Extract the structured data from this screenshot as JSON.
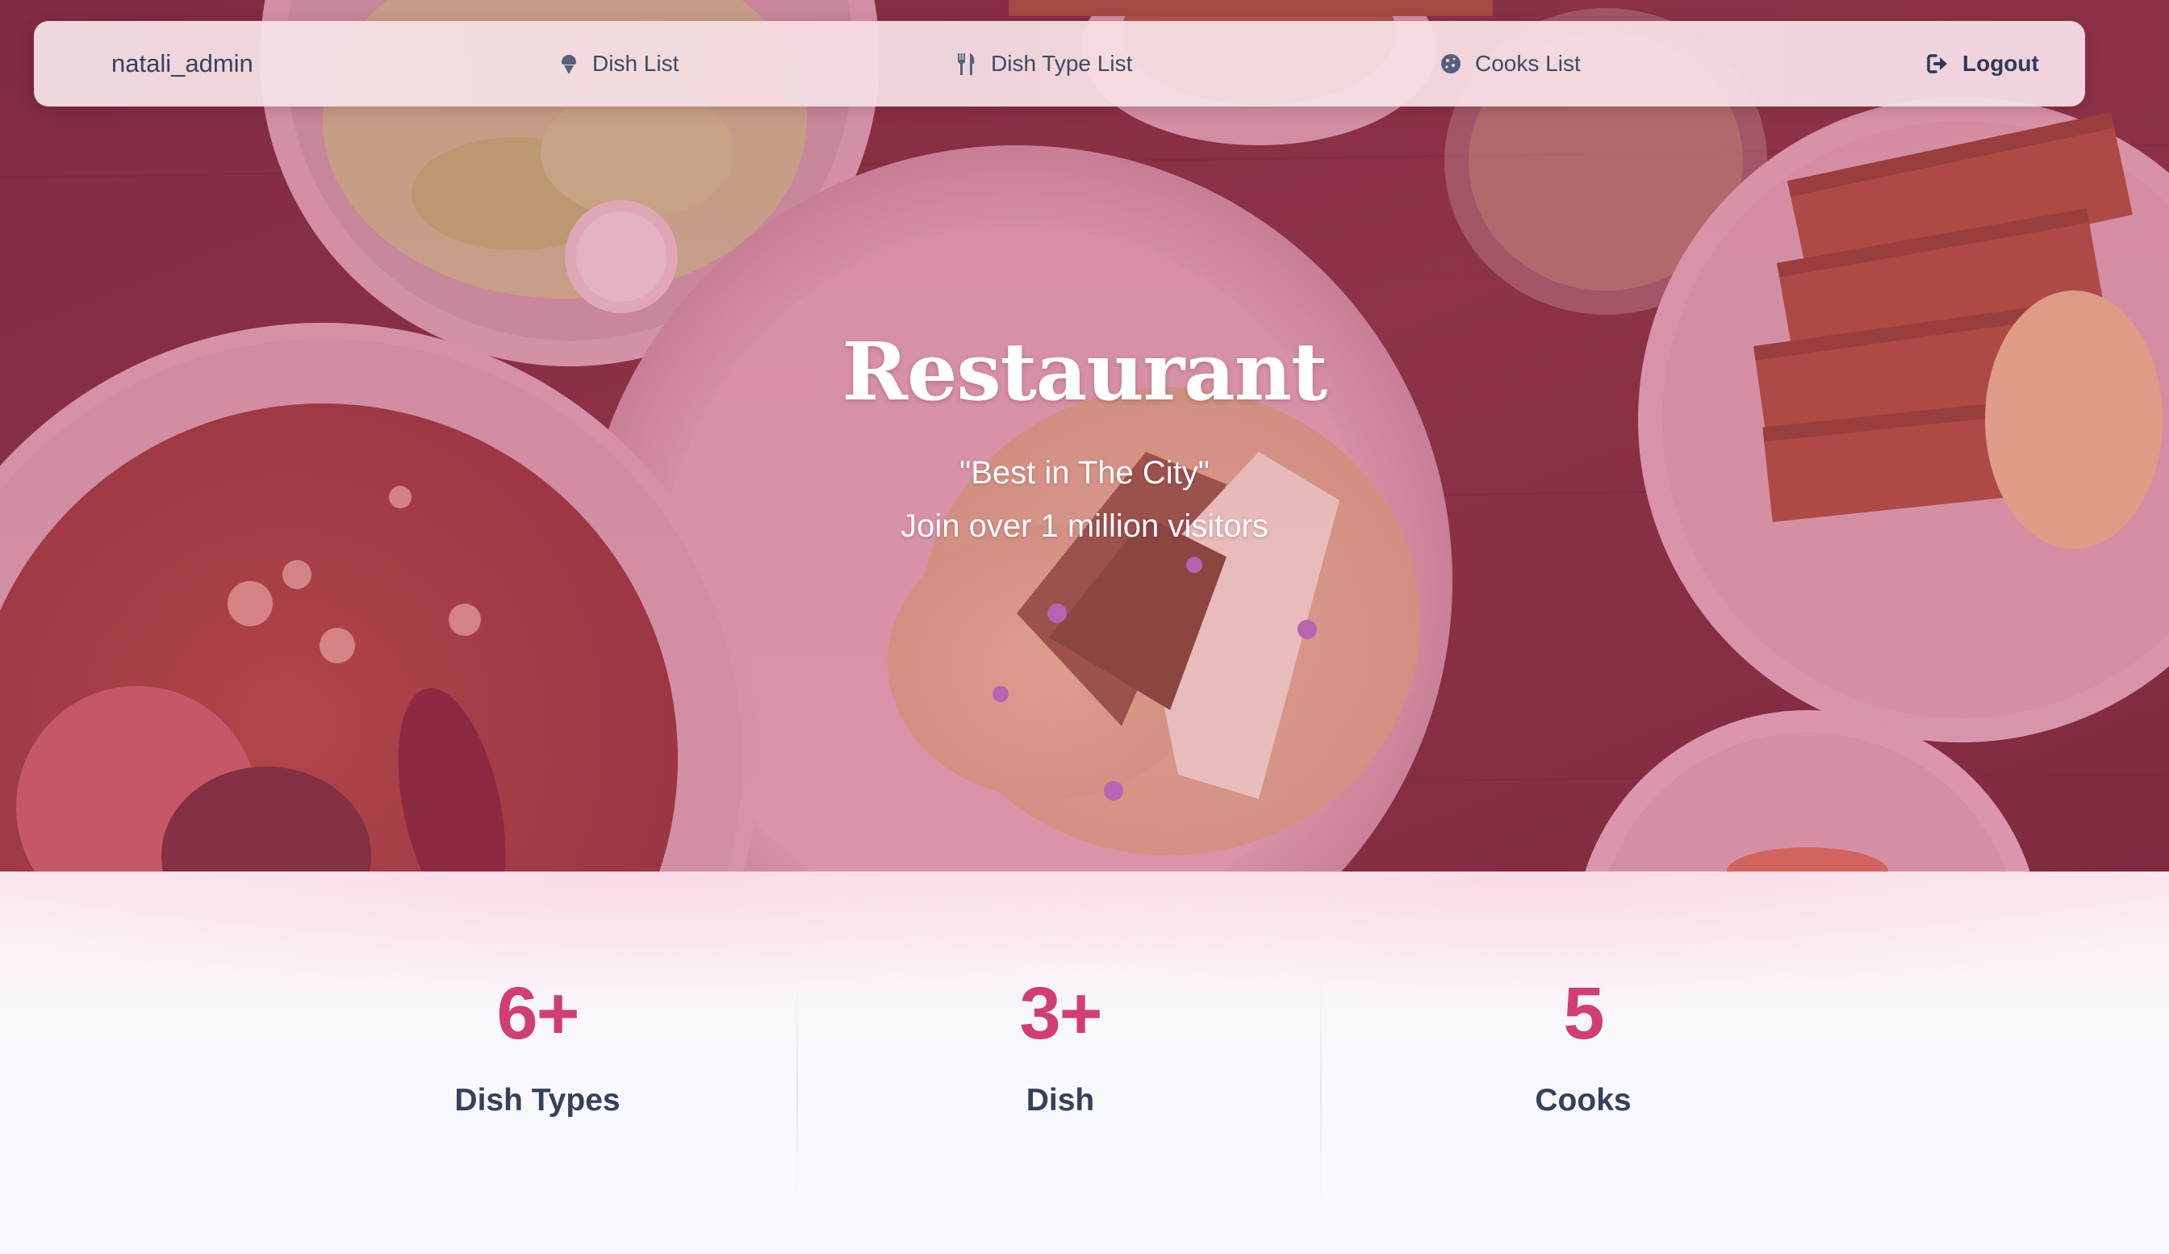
{
  "navbar": {
    "brand": "natali_admin",
    "links": {
      "dish_list": "Dish List",
      "dish_type_list": "Dish Type List",
      "cooks_list": "Cooks List",
      "logout": "Logout"
    },
    "icons": {
      "dish_list": "ice-cream-icon",
      "dish_type_list": "utensils-icon",
      "cooks_list": "cookie-icon",
      "logout": "sign-out-icon"
    }
  },
  "hero": {
    "title": "Restaurant",
    "tagline": "\"Best in The City\"",
    "subtitle": "Join over 1 million visitors"
  },
  "stats": [
    {
      "value": "6+",
      "label": "Dish Types"
    },
    {
      "value": "3+",
      "label": "Dish"
    },
    {
      "value": "5",
      "label": "Cooks"
    }
  ],
  "colors": {
    "accent": "#d13d75",
    "text_dark": "#36405a",
    "navbar_bg": "#f5e0e6"
  }
}
